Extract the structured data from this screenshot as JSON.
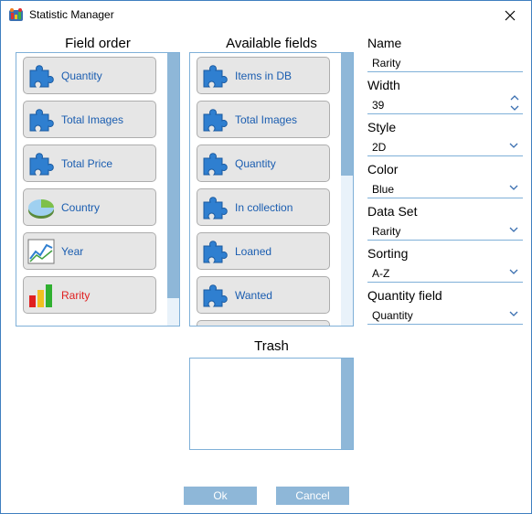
{
  "window": {
    "title": "Statistic Manager"
  },
  "sections": {
    "field_order": "Field order",
    "available_fields": "Available fields",
    "trash": "Trash"
  },
  "field_order_items": [
    {
      "label": "Quantity",
      "icon": "puzzle-icon"
    },
    {
      "label": "Total Images",
      "icon": "puzzle-icon"
    },
    {
      "label": "Total Price",
      "icon": "puzzle-icon"
    },
    {
      "label": "Country",
      "icon": "pie-chart-icon"
    },
    {
      "label": "Year",
      "icon": "line-chart-icon"
    },
    {
      "label": "Rarity",
      "icon": "bar-chart-icon",
      "selected": true
    }
  ],
  "available_items": [
    {
      "label": "Items in DB",
      "icon": "puzzle-icon"
    },
    {
      "label": "Total Images",
      "icon": "puzzle-icon"
    },
    {
      "label": "Quantity",
      "icon": "puzzle-icon"
    },
    {
      "label": "In collection",
      "icon": "puzzle-icon"
    },
    {
      "label": "Loaned",
      "icon": "puzzle-icon"
    },
    {
      "label": "Wanted",
      "icon": "puzzle-icon"
    }
  ],
  "properties": {
    "name_label": "Name",
    "name_value": "Rarity",
    "width_label": "Width",
    "width_value": "39",
    "style_label": "Style",
    "style_value": "2D",
    "color_label": "Color",
    "color_value": "Blue",
    "dataset_label": "Data Set",
    "dataset_value": "Rarity",
    "sorting_label": "Sorting",
    "sorting_value": "A-Z",
    "quantity_label": "Quantity field",
    "quantity_value": "Quantity"
  },
  "buttons": {
    "ok": "Ok",
    "cancel": "Cancel"
  },
  "colors": {
    "accent": "#8eb7d8",
    "link_text": "#1a5db0",
    "selected_text": "#e02020",
    "border": "#7fb0d8"
  }
}
